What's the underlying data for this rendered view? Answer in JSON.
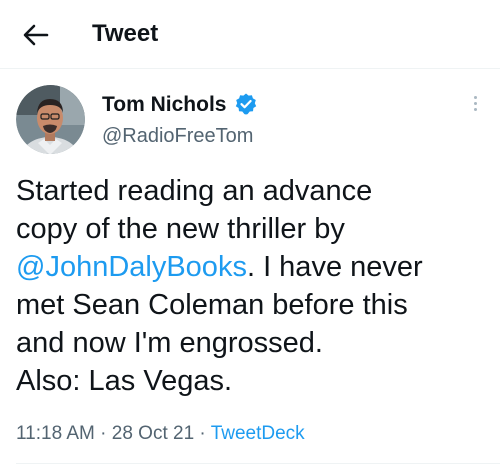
{
  "header": {
    "title": "Tweet",
    "back_icon": "arrow-left-icon"
  },
  "tweet": {
    "author": {
      "name": "Tom Nichols",
      "handle": "@RadioFreeTom",
      "verified_icon": "verified-badge-icon",
      "verified_color": "#1d9bf0"
    },
    "text": {
      "line1": "Started reading an advance",
      "line2": "copy of the new thriller by",
      "mention": "@JohnDalyBooks",
      "line3_rest": ". I have never",
      "line4": "met Sean Coleman before this",
      "line5": "and now I'm engrossed.",
      "line6": "Also: Las Vegas."
    },
    "meta": {
      "time": "11:18 AM",
      "separator1": " · ",
      "date": "28 Oct 21",
      "separator2": " · ",
      "source": "TweetDeck"
    },
    "more_icon": "more-vertical-icon"
  },
  "colors": {
    "accent": "#1d9bf0",
    "text": "#0f1419",
    "secondary": "#536471",
    "divider": "#eff3f4"
  }
}
